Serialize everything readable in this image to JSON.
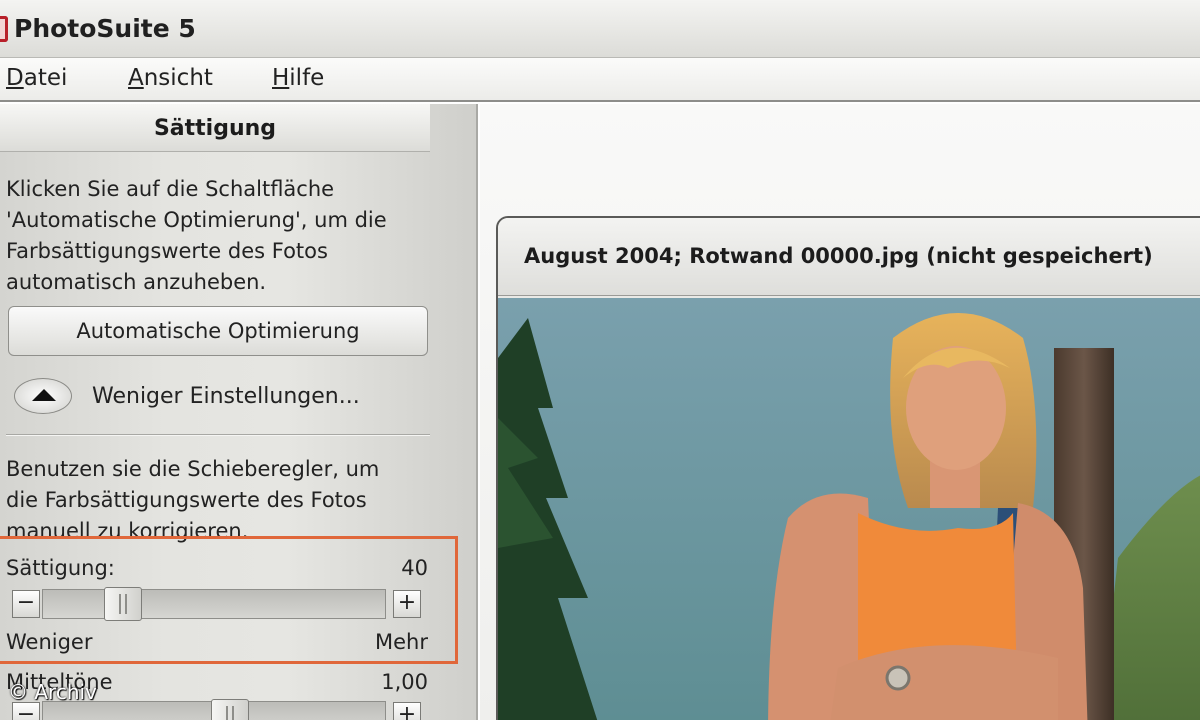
{
  "app": {
    "title": "PhotoSuite 5"
  },
  "menu": [
    {
      "label_ul": "D",
      "label_rest": "atei"
    },
    {
      "label_ul": "A",
      "label_rest": "nsicht"
    },
    {
      "label_ul": "H",
      "label_rest": "ilfe"
    }
  ],
  "panel": {
    "title": "Sättigung",
    "intro_lines": [
      "Klicken Sie auf die Schaltfläche",
      "'Automatische Optimierung', um die",
      "Farbsättigungswerte des Fotos",
      "automatisch anzuheben."
    ],
    "auto_button": "Automatische Optimierung",
    "collapse_label": "Weniger Einstellungen...",
    "manual_lines": [
      "Benutzen sie die Schieberegler, um",
      "die Farbsättigungswerte des Fotos",
      "manuell zu korrigieren."
    ],
    "sliders": [
      {
        "label": "Sättigung:",
        "value": "40",
        "fraction": 0.2,
        "min_label": "Weniger",
        "max_label": "Mehr"
      },
      {
        "label": "Mitteltöne",
        "value": "1,00",
        "fraction": 0.55
      }
    ],
    "step_minus": "−",
    "step_plus": "+",
    "highlight_color": "#e0673a"
  },
  "photo_window": {
    "title": "August 2004; Rotwand 00000.jpg (nicht gespeichert)"
  },
  "watermark": "© Archiv",
  "icons": {
    "collapse": "triangle-up-icon",
    "app": "photosuite-app-icon"
  }
}
